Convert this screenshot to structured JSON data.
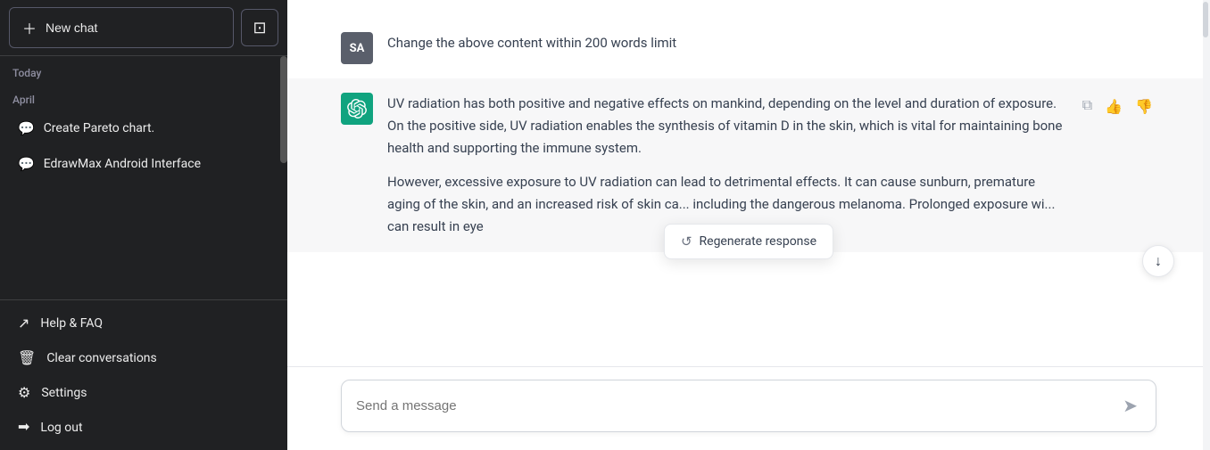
{
  "sidebar": {
    "new_chat_label": "New chat",
    "layout_icon": "⊡",
    "today_label": "Today",
    "april_label": "April",
    "chat_items": [
      {
        "id": "create-pareto",
        "label": "Create Pareto chart."
      },
      {
        "id": "edrawmax-android",
        "label": "EdrawMax Android Interface"
      }
    ],
    "footer_items": [
      {
        "id": "help-faq",
        "icon": "↗",
        "label": "Help & FAQ"
      },
      {
        "id": "clear-conversations",
        "icon": "🗑",
        "label": "Clear conversations"
      },
      {
        "id": "settings",
        "icon": "⚙",
        "label": "Settings"
      },
      {
        "id": "log-out",
        "icon": "→",
        "label": "Log out"
      }
    ]
  },
  "main": {
    "user_message": {
      "avatar_initials": "SA",
      "text": "Change the above content within 200 words limit"
    },
    "ai_message": {
      "paragraph1": "UV radiation has both positive and negative effects on mankind, depending on the level and duration of exposure. On the positive side, UV radiation enables the synthesis of vitamin D in the skin, which is vital for maintaining bone health and supporting the immune system.",
      "paragraph2": "However, excessive exposure to UV radiation can lead to detrimental effects. It can cause sunburn, premature aging of the skin, and an increased risk of skin ca... including the dangerous melanoma. Prolonged exposure wi... can result in eye"
    },
    "regenerate_label": "Regenerate response",
    "input_placeholder": "Send a message",
    "action_icons": {
      "copy": "📋",
      "thumbup": "👍",
      "thumbdown": "👎"
    }
  }
}
